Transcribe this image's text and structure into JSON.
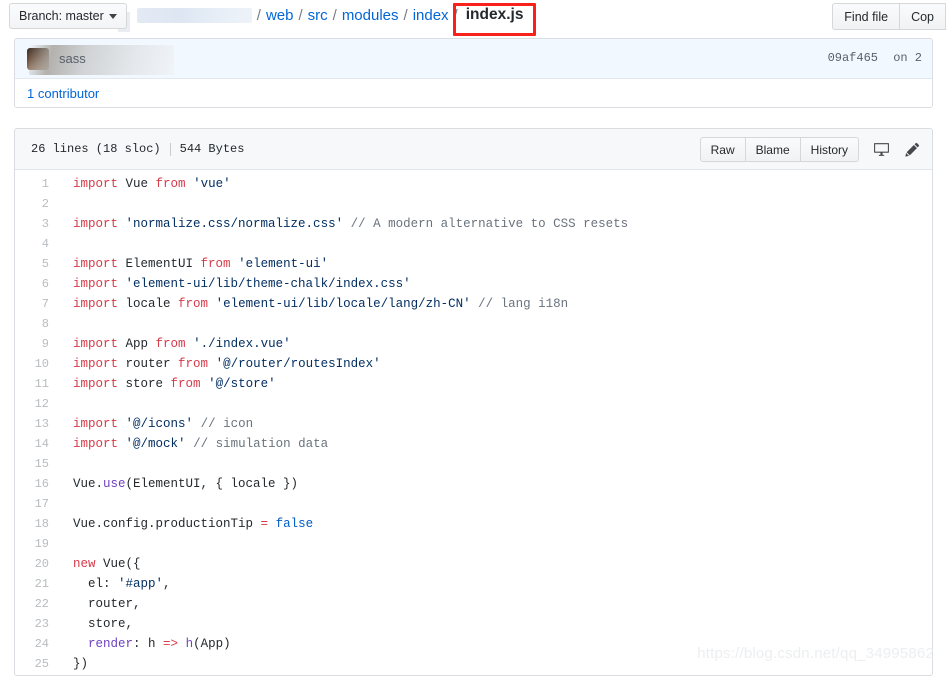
{
  "topbar": {
    "branch_label": "Branch: master",
    "breadcrumb": {
      "repo_redacted": "",
      "items": [
        {
          "label": "web",
          "link": true
        },
        {
          "label": "src",
          "link": true
        },
        {
          "label": "modules",
          "link": true
        },
        {
          "label": "index",
          "link": true
        }
      ],
      "current_file": "index.js",
      "separator": "/"
    },
    "actions": [
      {
        "label": "Find file"
      },
      {
        "label": "Cop"
      }
    ]
  },
  "commit": {
    "message": "sass",
    "hash": "09af465",
    "date": "on 2",
    "contributors_label": "1 contributor"
  },
  "file": {
    "lines_info": "26 lines (18 sloc)",
    "size": "544 Bytes",
    "buttons": [
      {
        "label": "Raw"
      },
      {
        "label": "Blame"
      },
      {
        "label": "History"
      }
    ],
    "icons": [
      {
        "name": "desktop-icon"
      },
      {
        "name": "pencil-icon"
      }
    ],
    "code_lines": [
      {
        "n": 1,
        "tokens": [
          {
            "t": "import",
            "c": "k"
          },
          {
            "t": " Vue ",
            "c": ""
          },
          {
            "t": "from",
            "c": "k"
          },
          {
            "t": " ",
            "c": ""
          },
          {
            "t": "'vue'",
            "c": "s"
          }
        ]
      },
      {
        "n": 2,
        "tokens": []
      },
      {
        "n": 3,
        "tokens": [
          {
            "t": "import",
            "c": "k"
          },
          {
            "t": " ",
            "c": ""
          },
          {
            "t": "'normalize.css/normalize.css'",
            "c": "s"
          },
          {
            "t": " ",
            "c": ""
          },
          {
            "t": "// A modern alternative to CSS resets",
            "c": "c"
          }
        ]
      },
      {
        "n": 4,
        "tokens": []
      },
      {
        "n": 5,
        "tokens": [
          {
            "t": "import",
            "c": "k"
          },
          {
            "t": " ElementUI ",
            "c": ""
          },
          {
            "t": "from",
            "c": "k"
          },
          {
            "t": " ",
            "c": ""
          },
          {
            "t": "'element-ui'",
            "c": "s"
          }
        ]
      },
      {
        "n": 6,
        "tokens": [
          {
            "t": "import",
            "c": "k"
          },
          {
            "t": " ",
            "c": ""
          },
          {
            "t": "'element-ui/lib/theme-chalk/index.css'",
            "c": "s"
          }
        ]
      },
      {
        "n": 7,
        "tokens": [
          {
            "t": "import",
            "c": "k"
          },
          {
            "t": " locale ",
            "c": ""
          },
          {
            "t": "from",
            "c": "k"
          },
          {
            "t": " ",
            "c": ""
          },
          {
            "t": "'element-ui/lib/locale/lang/zh-CN'",
            "c": "s"
          },
          {
            "t": " ",
            "c": ""
          },
          {
            "t": "// lang i18n",
            "c": "c"
          }
        ]
      },
      {
        "n": 8,
        "tokens": []
      },
      {
        "n": 9,
        "tokens": [
          {
            "t": "import",
            "c": "k"
          },
          {
            "t": " App ",
            "c": ""
          },
          {
            "t": "from",
            "c": "k"
          },
          {
            "t": " ",
            "c": ""
          },
          {
            "t": "'./index.vue'",
            "c": "s"
          }
        ]
      },
      {
        "n": 10,
        "tokens": [
          {
            "t": "import",
            "c": "k"
          },
          {
            "t": " router ",
            "c": ""
          },
          {
            "t": "from",
            "c": "k"
          },
          {
            "t": " ",
            "c": ""
          },
          {
            "t": "'@/router/routesIndex'",
            "c": "s"
          }
        ]
      },
      {
        "n": 11,
        "tokens": [
          {
            "t": "import",
            "c": "k"
          },
          {
            "t": " store ",
            "c": ""
          },
          {
            "t": "from",
            "c": "k"
          },
          {
            "t": " ",
            "c": ""
          },
          {
            "t": "'@/store'",
            "c": "s"
          }
        ]
      },
      {
        "n": 12,
        "tokens": []
      },
      {
        "n": 13,
        "tokens": [
          {
            "t": "import",
            "c": "k"
          },
          {
            "t": " ",
            "c": ""
          },
          {
            "t": "'@/icons'",
            "c": "s"
          },
          {
            "t": " ",
            "c": ""
          },
          {
            "t": "// icon",
            "c": "c"
          }
        ]
      },
      {
        "n": 14,
        "tokens": [
          {
            "t": "import",
            "c": "k"
          },
          {
            "t": " ",
            "c": ""
          },
          {
            "t": "'@/mock'",
            "c": "s"
          },
          {
            "t": " ",
            "c": ""
          },
          {
            "t": "// simulation data",
            "c": "c"
          }
        ]
      },
      {
        "n": 15,
        "tokens": []
      },
      {
        "n": 16,
        "tokens": [
          {
            "t": "Vue.",
            "c": ""
          },
          {
            "t": "use",
            "c": "f"
          },
          {
            "t": "(ElementUI, { locale })",
            "c": ""
          }
        ]
      },
      {
        "n": 17,
        "tokens": []
      },
      {
        "n": 18,
        "tokens": [
          {
            "t": "Vue.config.productionTip ",
            "c": ""
          },
          {
            "t": "=",
            "c": "k"
          },
          {
            "t": " ",
            "c": ""
          },
          {
            "t": "false",
            "c": "cn"
          }
        ]
      },
      {
        "n": 19,
        "tokens": []
      },
      {
        "n": 20,
        "tokens": [
          {
            "t": "new",
            "c": "k"
          },
          {
            "t": " Vue({",
            "c": ""
          }
        ]
      },
      {
        "n": 21,
        "tokens": [
          {
            "t": "  el: ",
            "c": ""
          },
          {
            "t": "'#app'",
            "c": "s"
          },
          {
            "t": ",",
            "c": ""
          }
        ]
      },
      {
        "n": 22,
        "tokens": [
          {
            "t": "  router,",
            "c": ""
          }
        ]
      },
      {
        "n": 23,
        "tokens": [
          {
            "t": "  store,",
            "c": ""
          }
        ]
      },
      {
        "n": 24,
        "tokens": [
          {
            "t": "  ",
            "c": ""
          },
          {
            "t": "render",
            "c": "f"
          },
          {
            "t": ": h ",
            "c": ""
          },
          {
            "t": "=>",
            "c": "k"
          },
          {
            "t": " ",
            "c": ""
          },
          {
            "t": "h",
            "c": "f"
          },
          {
            "t": "(App)",
            "c": ""
          }
        ]
      },
      {
        "n": 25,
        "tokens": [
          {
            "t": "})",
            "c": ""
          }
        ]
      }
    ]
  },
  "watermark": {
    "text": "https://blog.csdn.net/qq_34995862"
  },
  "colors": {
    "link": "#0366d6",
    "annotation_red": "#f8211b",
    "keyword": "#d73a49",
    "string": "#032f62",
    "comment": "#6a737d",
    "function": "#6f42c1",
    "constant": "#005cc5"
  }
}
